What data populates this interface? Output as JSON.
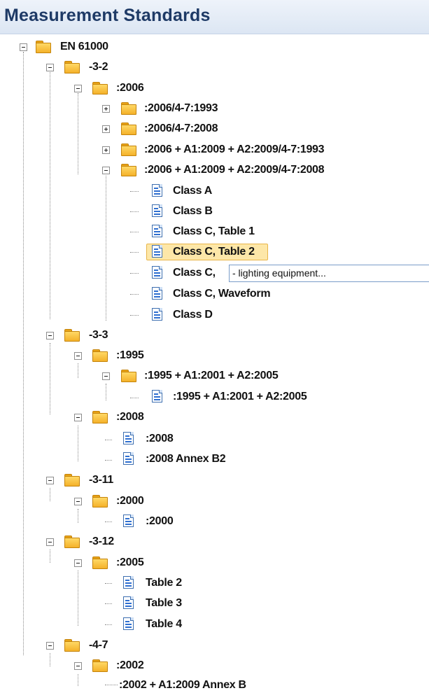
{
  "window": {
    "title": "Measurement Standards"
  },
  "tree": {
    "nodes": [
      {
        "label": "EN 61000"
      },
      {
        "label": "-3-2"
      },
      {
        "label": ":2006"
      },
      {
        "label": ":2006/4-7:1993"
      },
      {
        "label": ":2006/4-7:2008"
      },
      {
        "label": ":2006 + A1:2009 + A2:2009/4-7:1993"
      },
      {
        "label": ":2006 + A1:2009 + A2:2009/4-7:2008"
      },
      {
        "label": "Class A"
      },
      {
        "label": "Class B"
      },
      {
        "label": "Class C, Table 1"
      },
      {
        "label": "Class C, Table 2"
      },
      {
        "label": "Class C,"
      },
      {
        "label": "Class C, Waveform"
      },
      {
        "label": "Class D"
      },
      {
        "label": "-3-3"
      },
      {
        "label": ":1995"
      },
      {
        "label": ":1995 + A1:2001 + A2:2005"
      },
      {
        "label": ":1995 + A1:2001 + A2:2005"
      },
      {
        "label": ":2008"
      },
      {
        "label": ":2008"
      },
      {
        "label": ":2008 Annex B2"
      },
      {
        "label": "-3-11"
      },
      {
        "label": ":2000"
      },
      {
        "label": ":2000"
      },
      {
        "label": "-3-12"
      },
      {
        "label": ":2005"
      },
      {
        "label": "Table 2"
      },
      {
        "label": "Table 3"
      },
      {
        "label": "Table 4"
      },
      {
        "label": "-4-7"
      },
      {
        "label": ":2002"
      },
      {
        "label": ":2002 + A1:2009 Annex B"
      }
    ],
    "rename_edit_value": "- lighting equipment..."
  },
  "colors": {
    "header_text": "#1e3a66",
    "selection_fill": "#fde7a8",
    "folder": "#f4b12a",
    "document_icon": "#2f6fd0"
  },
  "icons": {
    "folder": "folder-icon",
    "document": "document-icon",
    "expander": "expand-collapse-icon"
  }
}
